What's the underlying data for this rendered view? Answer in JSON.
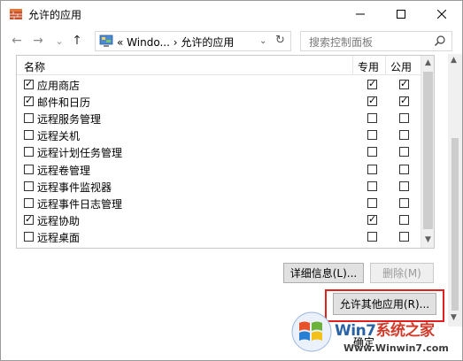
{
  "window": {
    "title": "允许的应用",
    "minimize_glyph": "—",
    "maximize_glyph": "☐",
    "close_glyph": "✕"
  },
  "nav": {
    "back_glyph": "←",
    "forward_glyph": "→",
    "recent_glyph": "⌄",
    "up_glyph": "↑",
    "address_prefix": "«",
    "address_seg1": "Windo...",
    "address_sep": "›",
    "address_seg2": "允许的应用",
    "address_dropdown": "⌄",
    "refresh_glyph": "↻",
    "search_placeholder": "搜索控制面板"
  },
  "list": {
    "columns": {
      "name": "名称",
      "private": "专用",
      "public": "公用"
    },
    "rows": [
      {
        "name": "应用商店",
        "enabled": true,
        "private": true,
        "public": true
      },
      {
        "name": "邮件和日历",
        "enabled": true,
        "private": true,
        "public": true
      },
      {
        "name": "远程服务管理",
        "enabled": false,
        "private": false,
        "public": false
      },
      {
        "name": "远程关机",
        "enabled": false,
        "private": false,
        "public": false
      },
      {
        "name": "远程计划任务管理",
        "enabled": false,
        "private": false,
        "public": false
      },
      {
        "name": "远程卷管理",
        "enabled": false,
        "private": false,
        "public": false
      },
      {
        "name": "远程事件监视器",
        "enabled": false,
        "private": false,
        "public": false
      },
      {
        "name": "远程事件日志管理",
        "enabled": false,
        "private": false,
        "public": false
      },
      {
        "name": "远程协助",
        "enabled": true,
        "private": true,
        "public": false
      },
      {
        "name": "远程桌面",
        "enabled": false,
        "private": false,
        "public": false
      }
    ]
  },
  "buttons": {
    "details": "详细信息(L)...",
    "delete": "删除(M)",
    "allow_other": "允许其他应用(R)...",
    "bottom_partial": "确定"
  },
  "watermark": {
    "brand_part1": "Win7",
    "brand_part2": "系统之家",
    "url": "Www.Winwin7.com"
  },
  "colors": {
    "highlight": "#e02020",
    "brand_blue": "#2a62a8"
  }
}
